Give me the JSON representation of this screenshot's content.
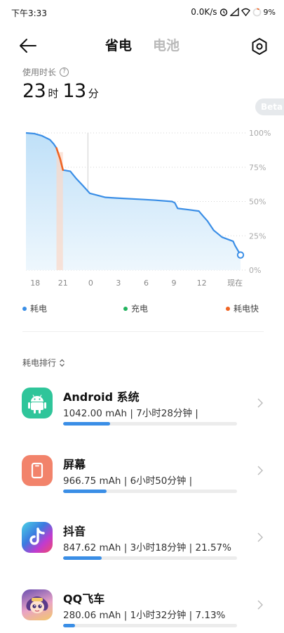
{
  "status_bar": {
    "time": "下午3:33",
    "network_speed": "0.0K/s",
    "battery_percent": "9%"
  },
  "header": {
    "tabs": [
      {
        "label": "省电",
        "active": true
      },
      {
        "label": "电池",
        "active": false
      }
    ]
  },
  "usage": {
    "label": "使用时长",
    "hours": "23",
    "hours_unit": "时",
    "minutes": "13",
    "minutes_unit": "分"
  },
  "beta_label": "Beta",
  "chart_data": {
    "type": "area",
    "x_tick_labels": [
      "18",
      "21",
      "0",
      "3",
      "6",
      "9",
      "12",
      "现在"
    ],
    "y_tick_labels": [
      "100%",
      "75%",
      "50%",
      "25%",
      "0%"
    ],
    "ylim": [
      0,
      100
    ],
    "x_range_hours": [
      0,
      23.2
    ],
    "series": [
      {
        "name": "耗电",
        "color": "#3a8ee6",
        "points": [
          [
            0,
            100
          ],
          [
            0.9,
            99.5
          ],
          [
            1.7,
            98
          ],
          [
            2.6,
            95
          ],
          [
            3.0,
            92
          ],
          [
            3.3,
            89
          ],
          [
            3.5,
            85
          ],
          [
            3.7,
            81
          ],
          [
            4.0,
            73
          ],
          [
            4.8,
            72
          ],
          [
            5.4,
            67
          ],
          [
            6.1,
            62
          ],
          [
            6.9,
            56
          ],
          [
            8.6,
            53
          ],
          [
            9.8,
            52.5
          ],
          [
            12.6,
            51.5
          ],
          [
            13.9,
            51
          ],
          [
            15.8,
            50
          ],
          [
            16.1,
            49
          ],
          [
            16.4,
            45
          ],
          [
            17.6,
            44
          ],
          [
            18.7,
            43
          ],
          [
            19.2,
            39
          ],
          [
            19.6,
            36
          ],
          [
            20.3,
            29
          ],
          [
            21.2,
            24
          ],
          [
            22.4,
            21
          ],
          [
            22.6,
            18
          ],
          [
            23.2,
            11
          ]
        ]
      }
    ],
    "fast_drain_segment": {
      "name": "耗电快",
      "color": "#f06423",
      "x_start_hours": 3.3,
      "x_end_hours": 4.0
    },
    "current_x_hours": 6.7,
    "grid": true
  },
  "legend": [
    {
      "label": "耗电",
      "color": "#3a8ee6"
    },
    {
      "label": "充电",
      "color": "#22b35e"
    },
    {
      "label": "耗电快",
      "color": "#f06423"
    }
  ],
  "ranking": {
    "sort_label": "耗电排行",
    "apps": [
      {
        "name": "Android 系统",
        "detail": "1042.00 mAh | 7小时28分钟 |",
        "share": 0.27,
        "icon": "android-icon",
        "icon_color": "#2fc59a"
      },
      {
        "name": "屏幕",
        "detail": "966.75 mAh | 6小时50分钟 |",
        "share": 0.25,
        "icon": "screen-icon",
        "icon_color": "#f2836b"
      },
      {
        "name": "抖音",
        "detail": "847.62 mAh | 3小时18分钟 | 21.57%",
        "share": 0.22,
        "icon": "tiktok-icon",
        "icon_color": "#1f1f2e"
      },
      {
        "name": "QQ飞车",
        "detail": "280.06 mAh | 1小时32分钟 | 7.13%",
        "share": 0.07,
        "icon": "qq-speed-game-icon",
        "icon_color": "#6a4fb0"
      }
    ]
  }
}
